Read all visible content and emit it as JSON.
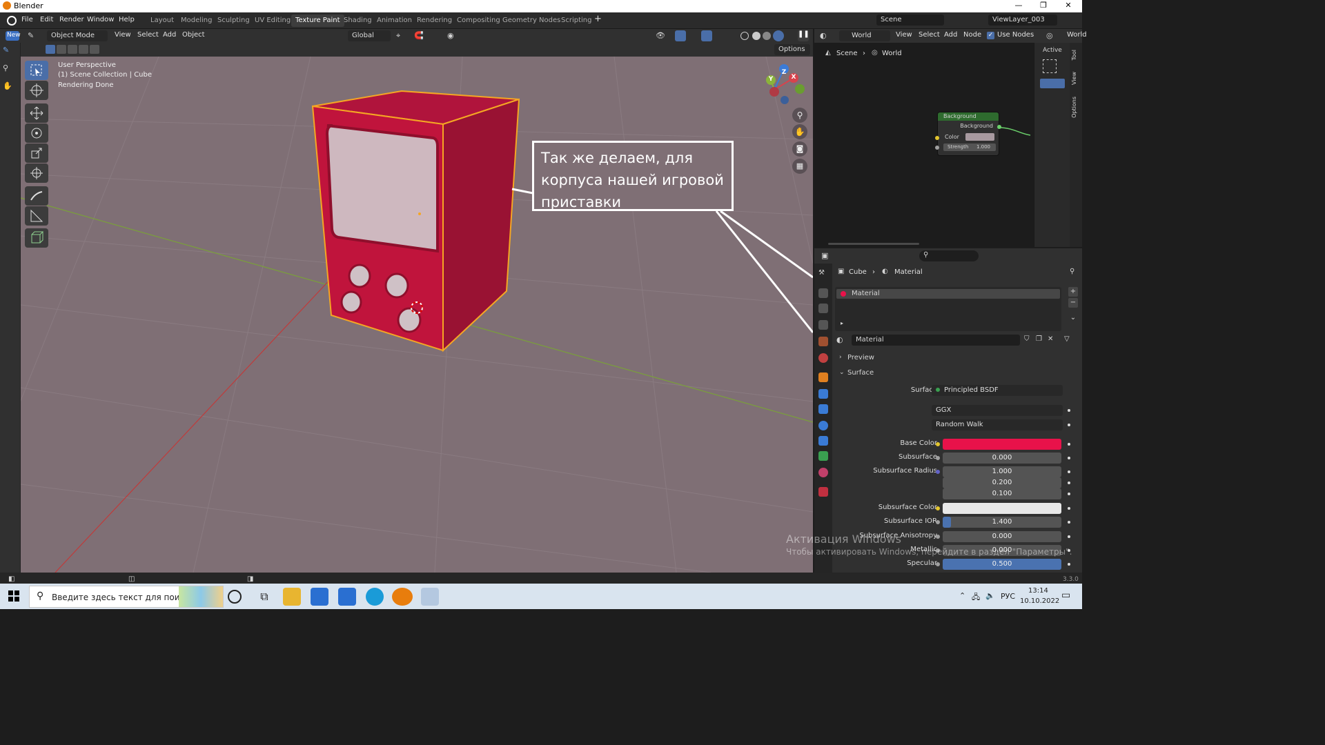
{
  "window": {
    "title": "Blender",
    "minimize": "—",
    "restore": "❐",
    "close": "✕"
  },
  "menu": [
    "File",
    "Edit",
    "Render",
    "Window",
    "Help"
  ],
  "workspaces": [
    "Layout",
    "Modeling",
    "Sculpting",
    "UV Editing",
    "Texture Paint",
    "Shading",
    "Animation",
    "Rendering",
    "Compositing",
    "Geometry Nodes",
    "Scripting"
  ],
  "active_workspace": "Texture Paint",
  "add_workspace": "+",
  "scene": {
    "name": "Scene",
    "view_layer": "ViewLayer_003"
  },
  "viewport_header": {
    "new_label": "New",
    "mode": "Object Mode",
    "menus": [
      "View",
      "Select",
      "Add",
      "Object"
    ],
    "orientation": "Global",
    "options": "Options"
  },
  "viewport_info": {
    "line1": "User Perspective",
    "line2": "(1) Scene Collection | Cube",
    "line3": "Rendering Done"
  },
  "gizmo": {
    "x": "X",
    "y": "Y",
    "z": "Z"
  },
  "annotation": {
    "text": "Так же делаем, для корпуса нашей игровой приставки"
  },
  "node_editor": {
    "world_label": "World",
    "menus": [
      "View",
      "Select",
      "Add",
      "Node"
    ],
    "use_nodes": "Use Nodes",
    "world_right": "World",
    "breadcrumb": [
      "Scene",
      "World"
    ],
    "node_title": "Background",
    "node_output": "Background",
    "node_color_label": "Color",
    "node_strength_label": "Strength",
    "node_strength_value": "1.000",
    "side_tabs": [
      "Tool",
      "View",
      "Options"
    ],
    "active_label": "Active"
  },
  "properties": {
    "breadcrumb": [
      "Cube",
      "Material"
    ],
    "slot_name": "Material",
    "material_name": "Material",
    "sections": {
      "preview": "Preview",
      "surface": "Surface"
    },
    "surface_label": "Surface",
    "surface_value": "Principled BSDF",
    "distribution": "GGX",
    "subsurface_method": "Random Walk",
    "rows": [
      {
        "label": "Base Color",
        "value": "",
        "color": "#e8124a",
        "dot": "#e3c52e"
      },
      {
        "label": "Subsurface",
        "value": "0.000",
        "dot": "#a0a0a0"
      },
      {
        "label": "Subsurface Radius",
        "value": "1.000",
        "dot": "#6363c7"
      },
      {
        "label": "",
        "value": "0.200"
      },
      {
        "label": "",
        "value": "0.100"
      },
      {
        "label": "Subsurface Color",
        "value": "",
        "color": "#e8e8e8",
        "dot": "#e3c52e"
      },
      {
        "label": "Subsurface IOR",
        "value": "1.400",
        "dot": "#a0a0a0",
        "fill": 0.07
      },
      {
        "label": "Subsurface Anisotropy",
        "value": "0.000",
        "dot": "#a0a0a0"
      },
      {
        "label": "Metallic",
        "value": "0.000",
        "dot": "#a0a0a0"
      },
      {
        "label": "Specular",
        "value": "0.500",
        "dot": "#a0a0a0",
        "fill": 1.0
      }
    ]
  },
  "status": {
    "version": "3.3.0"
  },
  "watermark": {
    "title": "Активация Windows",
    "subtitle": "Чтобы активировать Windows, перейдите в раздел \"Параметры\"."
  },
  "taskbar": {
    "search_placeholder": "Введите здесь текст для поиска",
    "language": "РУС",
    "time": "13:14",
    "date": "10.10.2022"
  },
  "colors": {
    "accent": "#4a6ea8",
    "material": "#c0143c",
    "selection": "#f5a623",
    "viewport_bg": "#7f6f75"
  }
}
